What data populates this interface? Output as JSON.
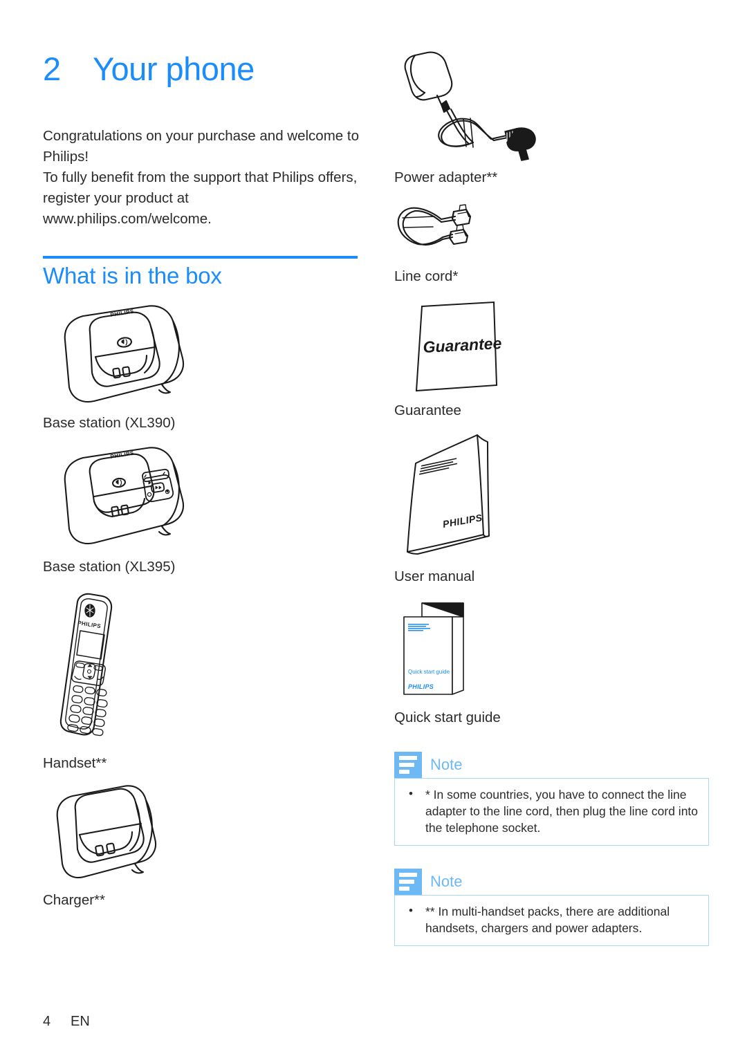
{
  "chapter": {
    "number": "2",
    "title": "Your phone"
  },
  "intro": {
    "line1": "Congratulations on your purchase and welcome to Philips!",
    "line2": "To fully benefit from the support that Philips offers, register your product at www.philips.com/welcome."
  },
  "section": {
    "heading": "What is in the box"
  },
  "box_contents": {
    "left_column": [
      {
        "figure": "base-station-xl390-illustration",
        "label": "Base station (XL390)",
        "brand": "PHILIPS"
      },
      {
        "figure": "base-station-xl395-illustration",
        "label": "Base station (XL395)",
        "brand": "PHILIPS"
      },
      {
        "figure": "handset-illustration",
        "label": "Handset**",
        "brand": "PHILIPS"
      },
      {
        "figure": "charger-illustration",
        "label": "Charger**"
      }
    ],
    "right_column": [
      {
        "figure": "power-adapter-illustration",
        "label": "Power adapter**"
      },
      {
        "figure": "line-cord-illustration",
        "label": "Line cord*"
      },
      {
        "figure": "guarantee-card-illustration",
        "label": "Guarantee",
        "cover_text": "Guarantee"
      },
      {
        "figure": "user-manual-illustration",
        "label": "User manual",
        "cover_brand": "PHILIPS"
      },
      {
        "figure": "quick-start-guide-illustration",
        "label": "Quick start guide",
        "cover_text": "Quick start guide",
        "cover_brand": "PHILIPS"
      }
    ]
  },
  "notes": [
    {
      "title": "Note",
      "icon": "note-lines-icon",
      "items": [
        "* In some countries, you have to connect the line adapter to the line cord, then plug the line cord into the telephone socket."
      ]
    },
    {
      "title": "Note",
      "icon": "note-lines-icon",
      "items": [
        "** In multi-handset packs, there are additional handsets, chargers and power adapters."
      ]
    }
  ],
  "footer": {
    "page_number": "4",
    "language": "EN"
  },
  "colors": {
    "accent_blue": "#1a8cfb",
    "note_blue": "#6cb9f5",
    "note_border": "#a9d7f7",
    "text": "#2b2b2b"
  }
}
